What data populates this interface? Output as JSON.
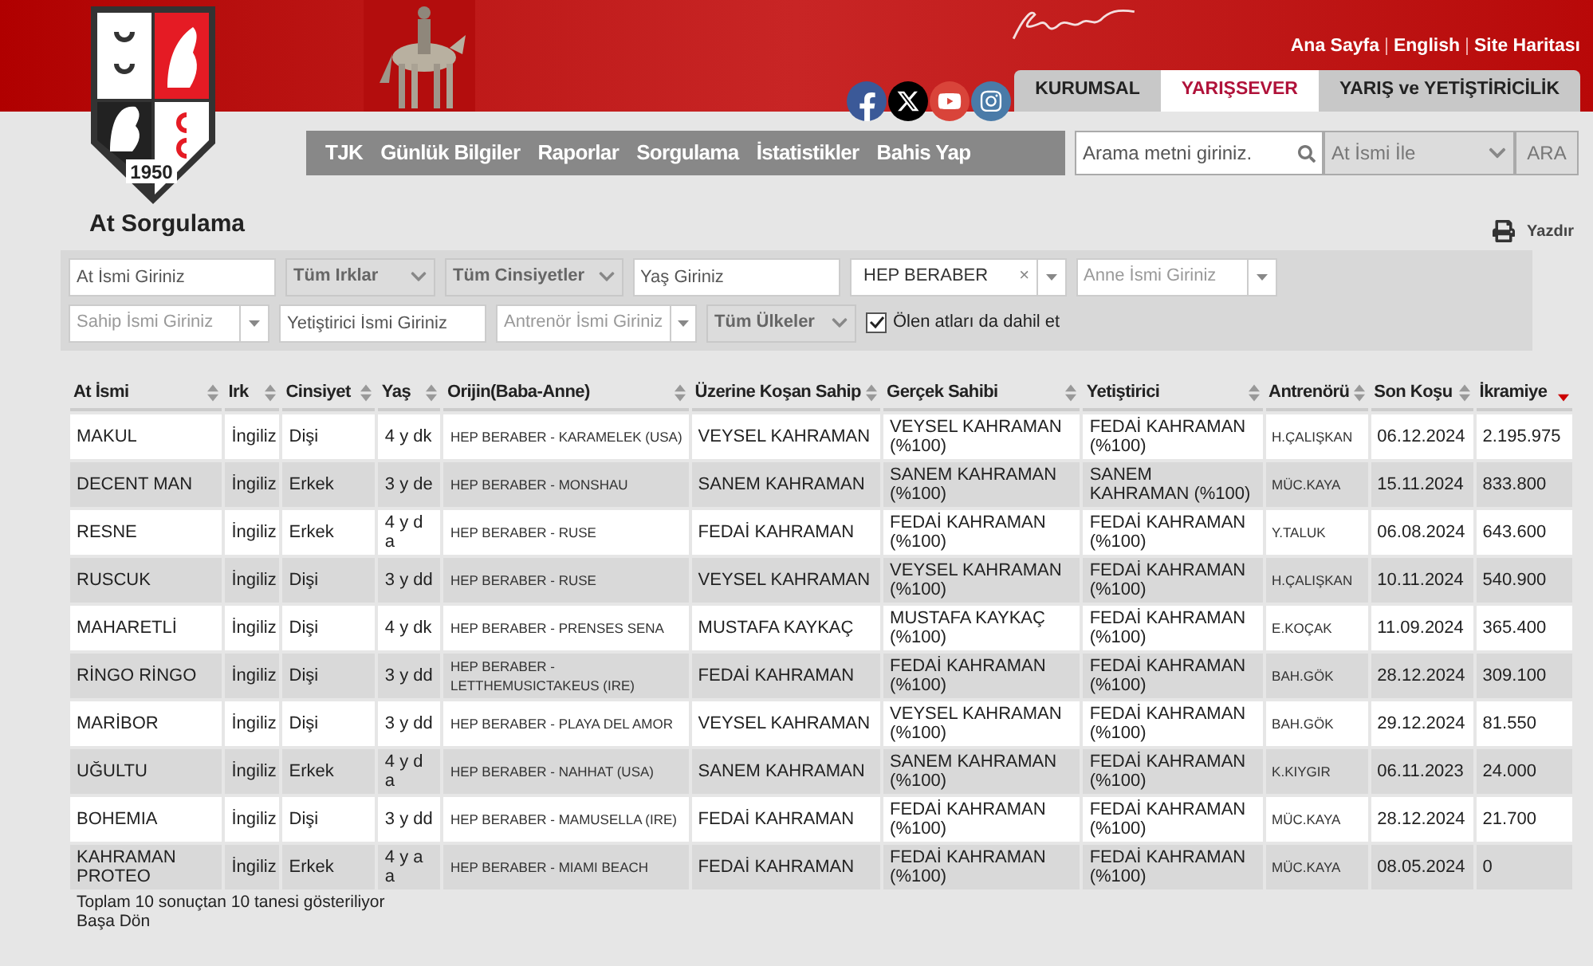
{
  "header": {
    "logo_year": "1950",
    "top_links": [
      "Ana Sayfa",
      "English",
      "Site Haritası"
    ],
    "link_separator": "|",
    "tabs": [
      {
        "label": "KURUMSAL",
        "selected": false
      },
      {
        "label": "YARIŞSEVER",
        "selected": true
      },
      {
        "label": "YARIŞ ve YETİŞTİRİCİLİK",
        "selected": false
      }
    ],
    "nav": [
      "TJK",
      "Günlük Bilgiler",
      "Raporlar",
      "Sorgulama",
      "İstatistikler",
      "Bahis Yap"
    ],
    "search": {
      "placeholder": "Arama metni giriniz.",
      "mode": "At İsmi İle",
      "button": "ARA"
    }
  },
  "page_title": "At Sorgulama",
  "print": "Yazdır",
  "filters": [
    [
      {
        "kind": "input",
        "placeholder": "At İsmi Giriniz"
      },
      {
        "kind": "select",
        "value": "Tüm Irklar"
      },
      {
        "kind": "select",
        "value": "Tüm Cinsiyetler"
      },
      {
        "kind": "input",
        "placeholder": "Yaş Giriniz"
      },
      {
        "kind": "tag",
        "value": "HEP BERABER",
        "remove": "×"
      },
      {
        "kind": "combo",
        "placeholder": "Anne İsmi Giriniz"
      }
    ],
    [
      {
        "kind": "combo",
        "placeholder": "Sahip İsmi Giriniz"
      },
      {
        "kind": "input",
        "placeholder": "Yetiştirici İsmi Giriniz"
      },
      {
        "kind": "combo",
        "placeholder": "Antrenör İsmi Giriniz"
      },
      {
        "kind": "select",
        "value": "Tüm Ülkeler"
      },
      {
        "kind": "checkbox",
        "label": "Ölen atları da dahil et",
        "checked": true
      }
    ]
  ],
  "table": {
    "columns": [
      {
        "label": "At İsmi",
        "sorted": false
      },
      {
        "label": "Irk",
        "sorted": false
      },
      {
        "label": "Cinsiyet",
        "sorted": false
      },
      {
        "label": "Yaş",
        "sorted": false
      },
      {
        "label": "Orijin(Baba-Anne)",
        "sorted": false
      },
      {
        "label": "Üzerine Koşan Sahip",
        "sorted": false
      },
      {
        "label": "Gerçek Sahibi",
        "sorted": false
      },
      {
        "label": "Yetiştirici",
        "sorted": false
      },
      {
        "label": "Antrenörü",
        "sorted": false
      },
      {
        "label": "Son Koşu",
        "sorted": false
      },
      {
        "label": "İkramiye",
        "sorted": true
      }
    ],
    "rows": [
      [
        "MAKUL",
        "İngiliz",
        "Dişi",
        "4 y dk",
        "HEP BERABER - KARAMELEK (USA)",
        "VEYSEL KAHRAMAN",
        "VEYSEL KAHRAMAN (%100)",
        "FEDAİ KAHRAMAN (%100)",
        "H.ÇALIŞKAN",
        "06.12.2024",
        "2.195.975"
      ],
      [
        "DECENT MAN",
        "İngiliz",
        "Erkek",
        "3 y de",
        "HEP BERABER - MONSHAU",
        "SANEM KAHRAMAN",
        "SANEM KAHRAMAN (%100)",
        "SANEM KAHRAMAN (%100)",
        "MÜC.KAYA",
        "15.11.2024",
        "833.800"
      ],
      [
        "RESNE",
        "İngiliz",
        "Erkek",
        "4 y d a",
        "HEP BERABER - RUSE",
        "FEDAİ KAHRAMAN",
        "FEDAİ KAHRAMAN (%100)",
        "FEDAİ KAHRAMAN (%100)",
        "Y.TALUK",
        "06.08.2024",
        "643.600"
      ],
      [
        "RUSCUK",
        "İngiliz",
        "Dişi",
        "3 y dd",
        "HEP BERABER - RUSE",
        "VEYSEL KAHRAMAN",
        "VEYSEL KAHRAMAN (%100)",
        "FEDAİ KAHRAMAN (%100)",
        "H.ÇALIŞKAN",
        "10.11.2024",
        "540.900"
      ],
      [
        "MAHARETLİ",
        "İngiliz",
        "Dişi",
        "4 y dk",
        "HEP BERABER - PRENSES SENA",
        "MUSTAFA KAYKAÇ",
        "MUSTAFA KAYKAÇ (%100)",
        "FEDAİ KAHRAMAN (%100)",
        "E.KOÇAK",
        "11.09.2024",
        "365.400"
      ],
      [
        "RİNGO RİNGO",
        "İngiliz",
        "Dişi",
        "3 y dd",
        "HEP BERABER - LETTHEMUSICTAKEUS (IRE)",
        "FEDAİ KAHRAMAN",
        "FEDAİ KAHRAMAN (%100)",
        "FEDAİ KAHRAMAN (%100)",
        "BAH.GÖK",
        "28.12.2024",
        "309.100"
      ],
      [
        "MARİBOR",
        "İngiliz",
        "Dişi",
        "3 y dd",
        "HEP BERABER - PLAYA DEL AMOR",
        "VEYSEL KAHRAMAN",
        "VEYSEL KAHRAMAN (%100)",
        "FEDAİ KAHRAMAN (%100)",
        "BAH.GÖK",
        "29.12.2024",
        "81.550"
      ],
      [
        "UĞULTU",
        "İngiliz",
        "Erkek",
        "4 y d a",
        "HEP BERABER - NAHHAT (USA)",
        "SANEM KAHRAMAN",
        "SANEM KAHRAMAN (%100)",
        "FEDAİ KAHRAMAN (%100)",
        "K.KIYGIR",
        "06.11.2023",
        "24.000"
      ],
      [
        "BOHEMIA",
        "İngiliz",
        "Dişi",
        "3 y dd",
        "HEP BERABER - MAMUSELLA (IRE)",
        "FEDAİ KAHRAMAN",
        "FEDAİ KAHRAMAN (%100)",
        "FEDAİ KAHRAMAN (%100)",
        "MÜC.KAYA",
        "28.12.2024",
        "21.700"
      ],
      [
        "KAHRAMAN PROTEO",
        "İngiliz",
        "Erkek",
        "4 y a a",
        "HEP BERABER - MIAMI BEACH",
        "FEDAİ KAHRAMAN",
        "FEDAİ KAHRAMAN (%100)",
        "FEDAİ KAHRAMAN (%100)",
        "MÜC.KAYA",
        "08.05.2024",
        "0"
      ]
    ]
  },
  "footer": [
    "Toplam 10 sonuçtan 10 tanesi gösteriliyor",
    "Başa Dön"
  ]
}
